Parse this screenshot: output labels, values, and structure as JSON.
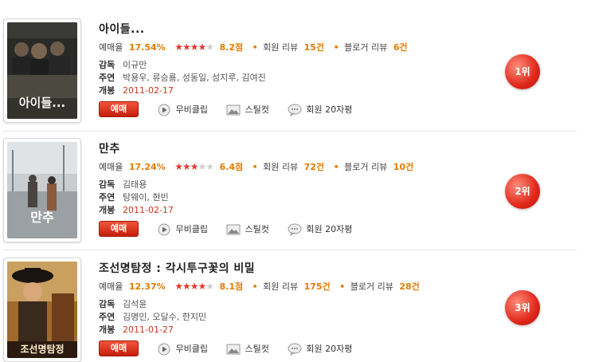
{
  "labels": {
    "rate": "예매율",
    "member_review": "회원 리뷰",
    "blogger_review": "블로거 리뷰",
    "director": "감독",
    "cast": "주연",
    "release": "개봉",
    "book": "예매",
    "movie_clip": "무비클립",
    "stillcut": "스틸컷",
    "member_ratings": "회원 20자평"
  },
  "colors": {
    "accent": "#e57b00",
    "button_red": "#d8321a",
    "star_on": "#e03a2f",
    "date_red": "#c8371f"
  },
  "movies": [
    {
      "title": "아이들...",
      "rate": "17.54%",
      "stars_filled": 4,
      "stars_total": 5,
      "score": "8.2점",
      "member_reviews": "15건",
      "blogger_reviews": "6건",
      "director": "이규만",
      "cast": "박용우, 류승룡, 성동일, 성지루, 김여진",
      "release": "2011-02-17",
      "rank": "1위",
      "poster_caption": "아이들..."
    },
    {
      "title": "만추",
      "rate": "17.24%",
      "stars_filled": 3,
      "stars_total": 5,
      "score": "6.4점",
      "member_reviews": "72건",
      "blogger_reviews": "10건",
      "director": "김태용",
      "cast": "탕웨이, 현빈",
      "release": "2011-02-17",
      "rank": "2위",
      "poster_caption": "만추"
    },
    {
      "title": "조선명탐정 : 각시투구꽃의 비밀",
      "rate": "12.37%",
      "stars_filled": 4,
      "stars_total": 5,
      "score": "8.1점",
      "member_reviews": "175건",
      "blogger_reviews": "28건",
      "director": "김석윤",
      "cast": "김명민, 오달수, 한지민",
      "release": "2011-01-27",
      "rank": "3위",
      "poster_caption": "조선명탐정"
    }
  ]
}
